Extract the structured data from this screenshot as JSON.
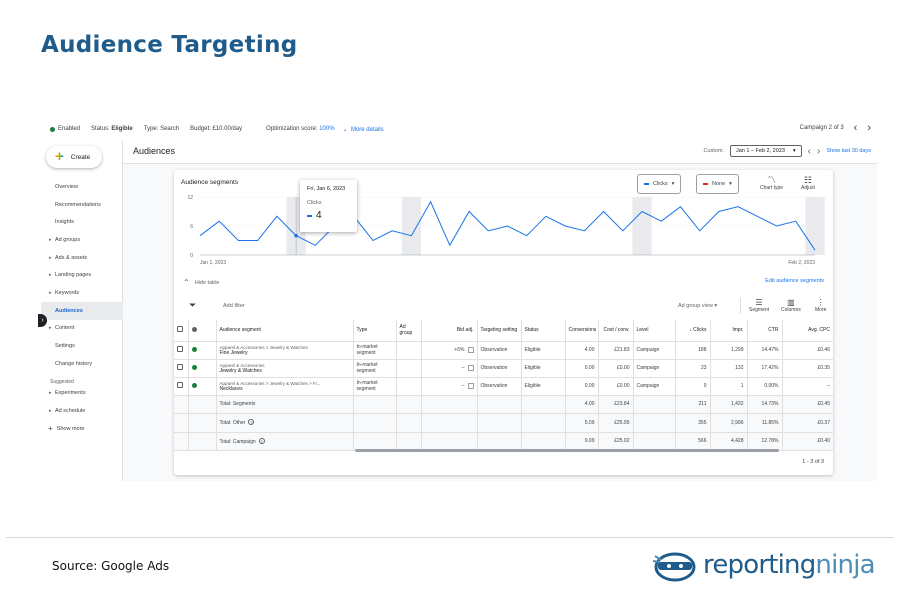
{
  "page_title": "Audience Targeting",
  "source": "Source: Google Ads",
  "logo": {
    "part1": "reporting",
    "part2": "ninja"
  },
  "topbar": {
    "status": "Enabled",
    "status_label": "Status:",
    "status_value": "Eligible",
    "type_label": "Type:",
    "type_value": "Search",
    "budget_label": "Budget:",
    "budget_value": "£10.00/day",
    "opt_label": "Optimization score:",
    "opt_value": "100%",
    "more_details": "More details",
    "campaign_pager": "Campaign 2 of 3"
  },
  "sidebar": {
    "create_label": "Create",
    "items": [
      {
        "label": "Overview",
        "expandable": false
      },
      {
        "label": "Recommendations",
        "expandable": false
      },
      {
        "label": "Insights",
        "expandable": false
      },
      {
        "label": "Ad groups",
        "expandable": true
      },
      {
        "label": "Ads & assets",
        "expandable": true
      },
      {
        "label": "Landing pages",
        "expandable": true
      },
      {
        "label": "Keywords",
        "expandable": true
      },
      {
        "label": "Audiences",
        "expandable": false,
        "active": true
      },
      {
        "label": "Content",
        "expandable": true
      },
      {
        "label": "Settings",
        "expandable": false
      },
      {
        "label": "Change history",
        "expandable": false
      }
    ],
    "suggested_label": "Suggested",
    "suggested_items": [
      {
        "label": "Experiments",
        "expandable": true
      },
      {
        "label": "Ad schedule",
        "expandable": true
      }
    ],
    "show_more": "Show more"
  },
  "header": {
    "title": "Audiences",
    "custom_label": "Custom",
    "date_range": "Jan 1 – Feb 2, 2023",
    "show_last": "Show last 30 days"
  },
  "card": {
    "title": "Audience segments",
    "metric1": "Clicks",
    "metric2": "None",
    "chart_type": "Chart type",
    "adjust": "Adjust",
    "hide_table": "Hide table",
    "edit_segments": "Edit audience segments",
    "add_filter": "Add filter",
    "ad_group_view": "Ad group view",
    "segment": "Segment",
    "columns": "Columns",
    "more": "More",
    "page_count": "1 - 3 of 3"
  },
  "tooltip": {
    "date": "Fri, Jan 6, 2023",
    "metric": "Clicks",
    "value": "4"
  },
  "chart_data": {
    "type": "line",
    "x_start_label": "Jan 1, 2023",
    "x_end_label": "Feb 2, 2023",
    "ylim": [
      0,
      12
    ],
    "yticks": [
      "12",
      "6",
      "0"
    ],
    "series": [
      {
        "name": "Clicks",
        "color": "#1a73e8",
        "values": [
          4,
          7,
          3,
          3,
          8,
          4,
          2,
          6,
          8,
          3,
          5,
          4,
          11,
          2,
          9,
          5,
          6,
          4,
          8,
          6,
          5,
          9,
          5,
          9,
          7,
          10,
          5,
          9,
          10,
          8,
          6,
          7,
          1
        ]
      }
    ],
    "highlight_bands": [
      5,
      11,
      23,
      32
    ],
    "grid": true,
    "legend": "none"
  },
  "table": {
    "headers": [
      "Audience segment",
      "Type",
      "Ad group",
      "Bid adj.",
      "Targeting setting",
      "Status",
      "Conversions",
      "Cost / conv.",
      "Level",
      "Clicks",
      "Impr.",
      "CTR",
      "Avg. CPC"
    ],
    "rows": [
      {
        "seg_path": "Apparel & Accessories > Jewelry & Watches",
        "seg_name": "Fine Jewelry",
        "type": "In-market segment",
        "ad_group": "",
        "bid": "+5%",
        "targeting": "Observation",
        "status": "Eligible",
        "conv": "4.00",
        "cost_conv": "£21.83",
        "level": "Campaign",
        "clicks": "188",
        "impr": "1,299",
        "ctr": "14.47%",
        "cpc": "£0.46"
      },
      {
        "seg_path": "Apparel & Accessories",
        "seg_name": "Jewelry & Watches",
        "type": "In-market segment",
        "ad_group": "",
        "bid": "–",
        "targeting": "Observation",
        "status": "Eligible",
        "conv": "0.00",
        "cost_conv": "£0.00",
        "level": "Campaign",
        "clicks": "23",
        "impr": "132",
        "ctr": "17.42%",
        "cpc": "£0.35"
      },
      {
        "seg_path": "Apparel & Accessories > Jewelry & Watches > Fi...",
        "seg_name": "Necklaces",
        "type": "In-market segment",
        "ad_group": "",
        "bid": "–",
        "targeting": "Observation",
        "status": "Eligible",
        "conv": "0.00",
        "cost_conv": "£0.00",
        "level": "Campaign",
        "clicks": "0",
        "impr": "1",
        "ctr": "0.00%",
        "cpc": "–"
      }
    ],
    "totals": [
      {
        "label": "Total: Segments",
        "help": false,
        "conv": "4.00",
        "cost_conv": "£23.84",
        "clicks": "211",
        "impr": "1,432",
        "ctr": "14.73%",
        "cpc": "£0.45"
      },
      {
        "label": "Total: Other",
        "help": true,
        "conv": "5.09",
        "cost_conv": "£25.95",
        "clicks": "355",
        "impr": "2,996",
        "ctr": "11.85%",
        "cpc": "£0.37"
      },
      {
        "label": "Total: Campaign",
        "help": true,
        "conv": "9.09",
        "cost_conv": "£25.02",
        "clicks": "566",
        "impr": "4,428",
        "ctr": "12.78%",
        "cpc": "£0.40"
      }
    ]
  },
  "colors": {
    "accent": "#1a73e8",
    "title": "#1f5c8b",
    "enabled": "#188038",
    "none_metric": "#d93025"
  }
}
